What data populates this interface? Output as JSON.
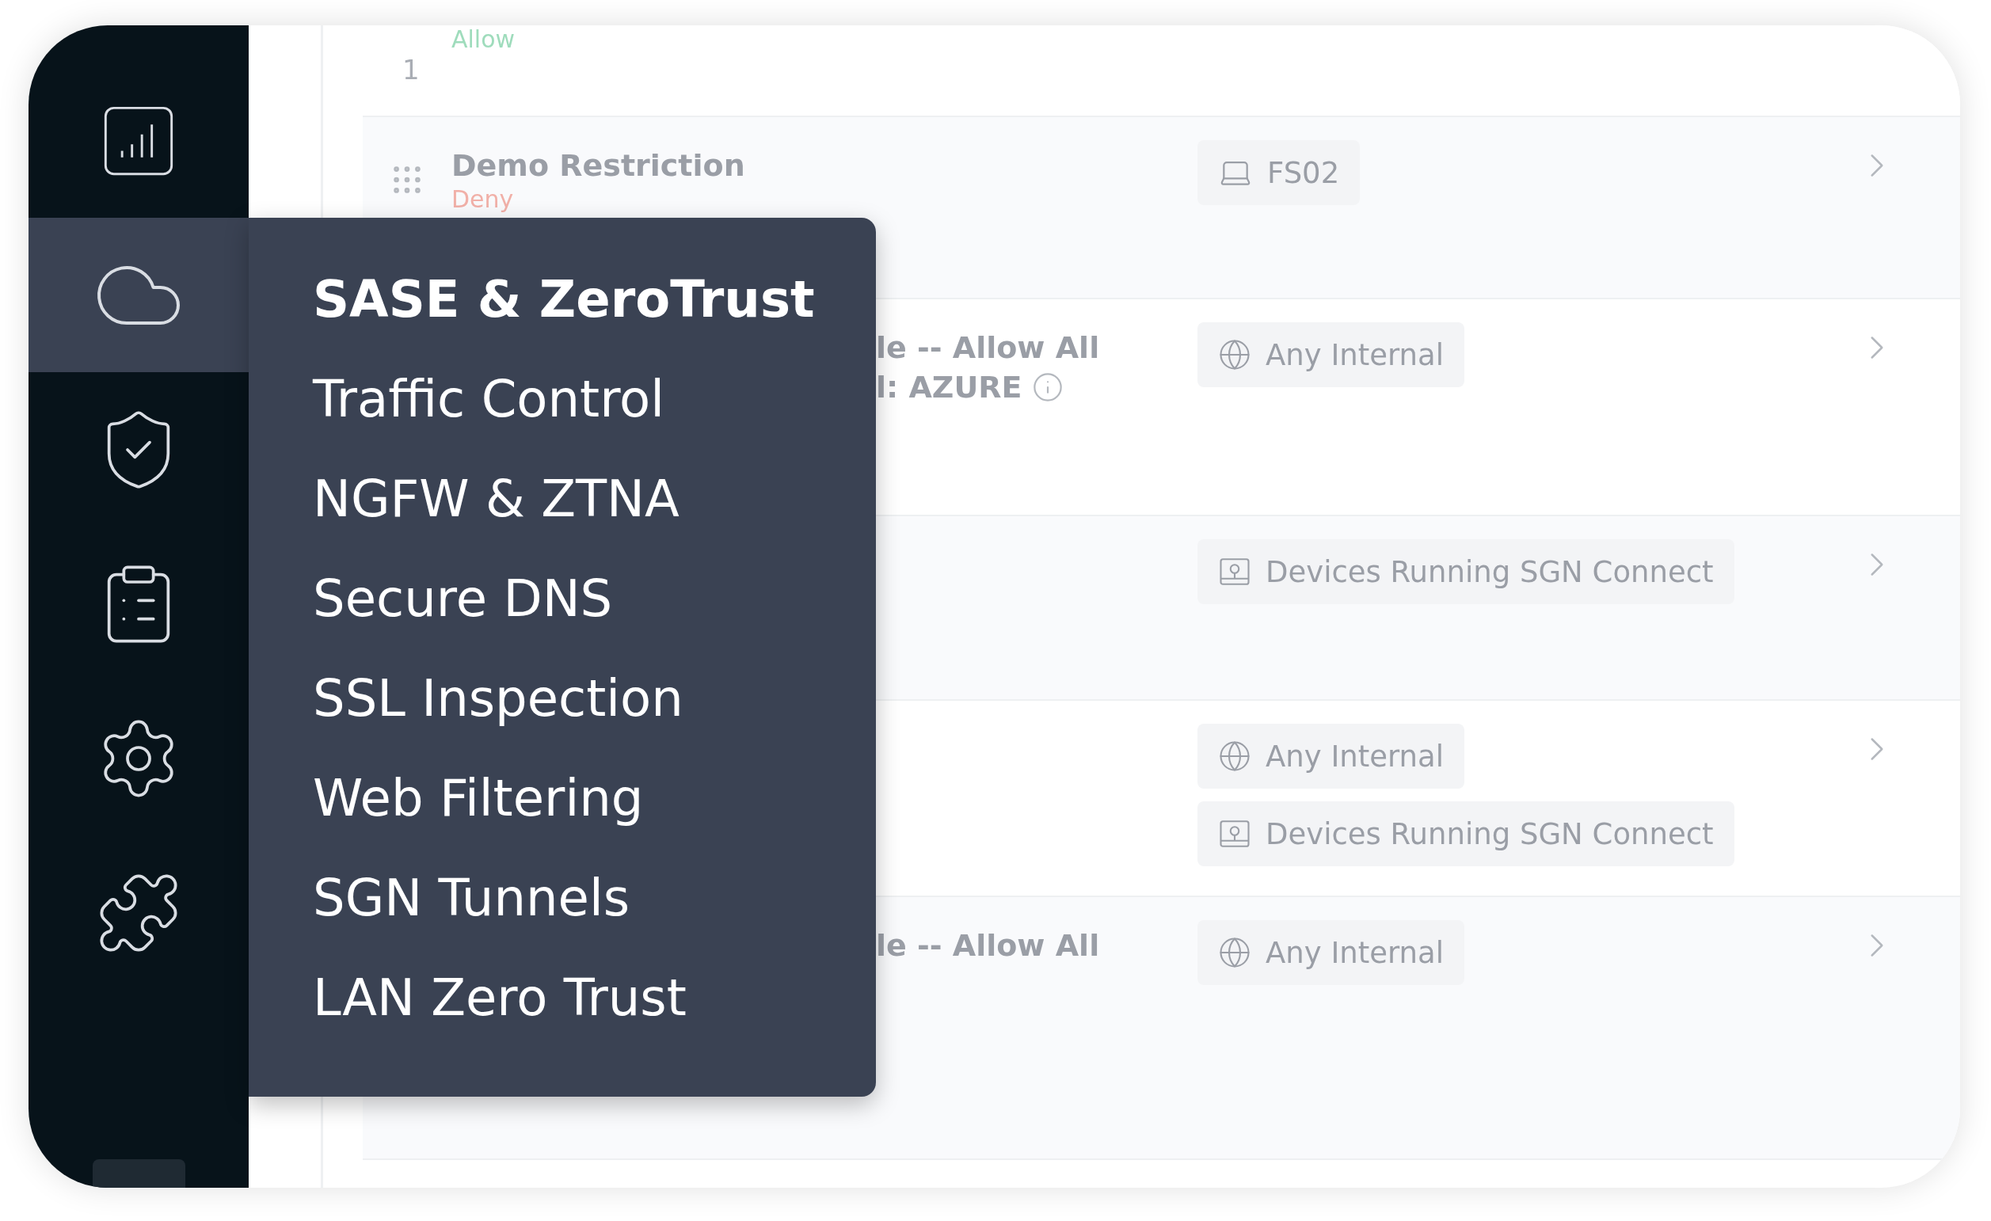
{
  "sidebar": {
    "items": [
      {
        "kind": "chart",
        "selected": false
      },
      {
        "kind": "cloud",
        "selected": true
      },
      {
        "kind": "shield",
        "selected": false
      },
      {
        "kind": "clipboard",
        "selected": false
      },
      {
        "kind": "gear",
        "selected": false
      },
      {
        "kind": "puzzle",
        "selected": false
      }
    ]
  },
  "menu": {
    "title": "SASE & ZeroTrust",
    "items": [
      "Traffic Control",
      "NGFW & ZTNA",
      "Secure DNS",
      "SSL Inspection",
      "Web Filtering",
      "SGN Tunnels",
      "LAN Zero Trust"
    ]
  },
  "rows": [
    {
      "number": "1",
      "action": {
        "text": "Allow",
        "kind": "allow"
      },
      "targets": []
    },
    {
      "title": "Demo Restriction",
      "covered": false,
      "action": {
        "text": "Deny",
        "kind": "deny"
      },
      "targets": [
        {
          "kind": "device",
          "text": "FS02"
        }
      ]
    },
    {
      "title": "le -- Allow All",
      "covered": true,
      "subtitle": "l: AZURE",
      "targets": [
        {
          "kind": "web",
          "text": "Any Internal"
        }
      ]
    },
    {
      "targets": [
        {
          "kind": "connect",
          "text": "Devices Running SGN Connect"
        }
      ]
    },
    {
      "targets": [
        {
          "kind": "web",
          "text": "Any Internal"
        },
        {
          "kind": "connect",
          "text": "Devices Running SGN Connect"
        }
      ]
    },
    {
      "title": "le -- Allow All",
      "covered": true,
      "targets": [
        {
          "kind": "web",
          "text": "Any Internal"
        }
      ]
    }
  ]
}
